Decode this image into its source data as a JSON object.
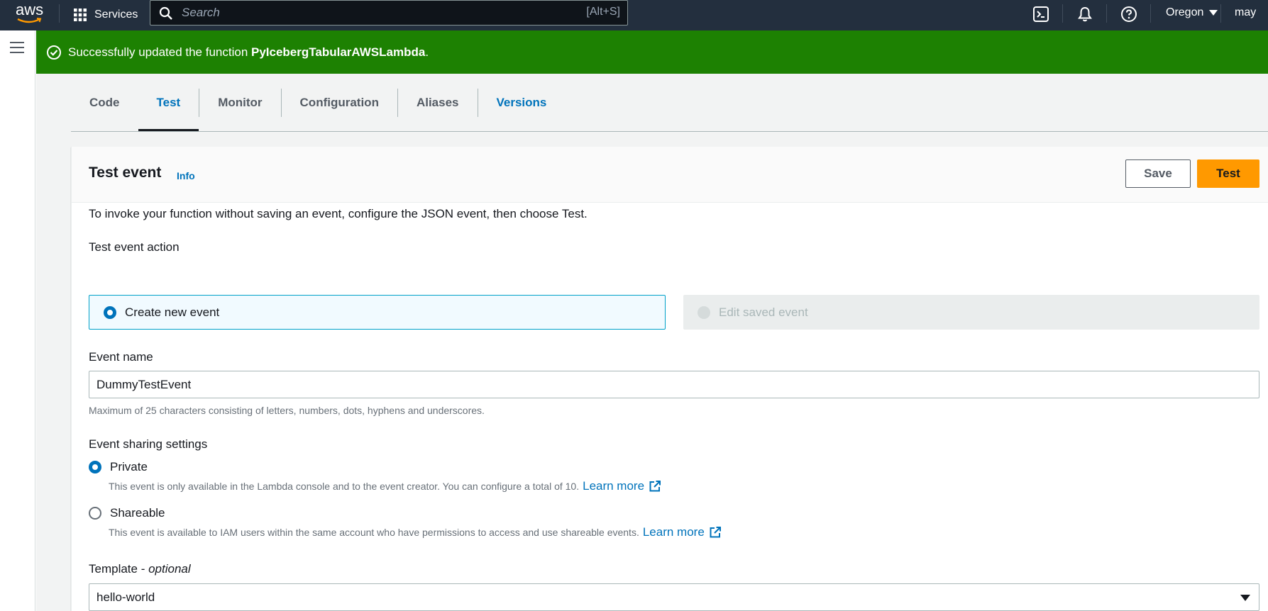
{
  "topnav": {
    "logo_text": "aws",
    "services_label": "Services",
    "search_placeholder": "Search",
    "search_shortcut": "[Alt+S]",
    "icons": [
      "cloudshell-icon",
      "bell-icon",
      "help-icon"
    ],
    "region": "Oregon",
    "account": "may"
  },
  "flash": {
    "prefix": "Successfully updated the function ",
    "function_name": "PyIcebergTabularAWSLambda",
    "suffix": ".",
    "color": "#1d8102"
  },
  "tabs": [
    "Code",
    "Test",
    "Monitor",
    "Configuration",
    "Aliases",
    "Versions"
  ],
  "active_tab": "Test",
  "test_event": {
    "title": "Test event",
    "info": "Info",
    "save_label": "Save",
    "test_label": "Test",
    "intro": "To invoke your function without saving an event, configure the JSON event, then choose Test.",
    "action_label": "Test event action",
    "create_new": "Create new event",
    "edit_saved": "Edit saved event",
    "event_name_label": "Event name",
    "event_name_value": "DummyTestEvent",
    "event_name_hint": "Maximum of 25 characters consisting of letters, numbers, dots, hyphens and underscores.",
    "sharing_label": "Event sharing settings",
    "private_label": "Private",
    "private_desc": "This event is only available in the Lambda console and to the event creator. You can configure a total of 10.",
    "shareable_label": "Shareable",
    "shareable_desc": "This event is available to IAM users within the same account who have permissions to access and use shareable events.",
    "learn_more": "Learn more",
    "template_label": "Template - ",
    "template_optional": "optional",
    "template_value": "hello-world"
  },
  "colors": {
    "nav_bg": "#232f3e",
    "accent": "#0073bb",
    "primary_button": "#ff9900"
  }
}
